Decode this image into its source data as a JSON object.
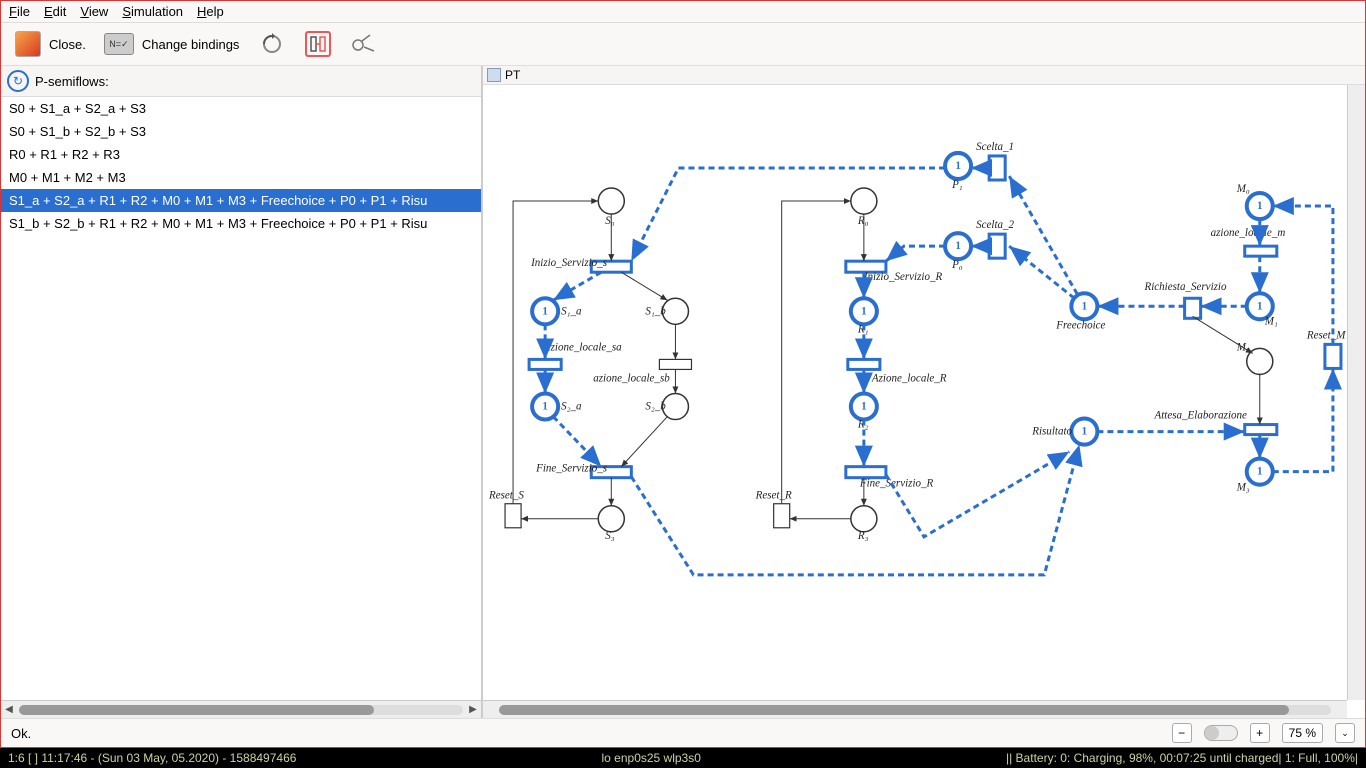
{
  "menubar": {
    "file": "File",
    "edit": "Edit",
    "view": "View",
    "simulation": "Simulation",
    "help": "Help"
  },
  "toolbar": {
    "close": "Close.",
    "change_bindings": "Change bindings"
  },
  "left": {
    "title": "P-semiflows:",
    "items": [
      "S0 + S1_a + S2_a + S3",
      "S0 + S1_b + S2_b + S3",
      "R0 + R1 + R2 + R3",
      "M0 + M1 + M2 + M3",
      "S1_a + S2_a + R1 + R2 + M0 + M1 + M3 + Freechoice + P0 + P1 + Risu",
      "S1_b + S2_b + R1 + R2 + M0 + M1 + M3 + Freechoice + P0 + P1 + Risu"
    ],
    "selected_index": 4
  },
  "tab": {
    "label": "PT"
  },
  "status": {
    "ok": "Ok."
  },
  "zoom": {
    "value": "75 %"
  },
  "sysbar": {
    "left": "1:6 [ ]    11:17:46 - (Sun 03 May, 05.2020) - 1588497466",
    "mid": "lo enp0s25 wlp3s0",
    "right": "||   Battery: 0: Charging, 98%, 00:07:25 until charged| 1: Full, 100%|"
  },
  "net": {
    "S0": "S₀",
    "S1a": "S₁_a",
    "S1b": "S₁_b",
    "S2a": "S₂_a",
    "S2b": "S₂_b",
    "S3": "S₃",
    "R0": "R₀",
    "R1": "R₁",
    "R2": "R₂",
    "R3": "R₃",
    "M0": "M₀",
    "M1": "M₁",
    "M2": "M₂",
    "M3": "M₃",
    "P0": "P₀",
    "P1": "P₁",
    "Freechoice": "Freechoice",
    "Risultato": "Risultato",
    "t_Inizio_S": "Inizio_Servizio_s",
    "t_az_sa": "azione_locale_sa",
    "t_az_sb": "azione_locale_sb",
    "t_Fine_S": "Fine_Servizio_s",
    "t_Reset_S": "Reset_S",
    "t_Inizio_R": "Inizio_Servizio_R",
    "t_az_R": "Azione_locale_R",
    "t_Fine_R": "Fine_Servizio_R",
    "t_Reset_R": "Reset_R",
    "t_Scelta1": "Scelta_1",
    "t_Scelta2": "Scelta_2",
    "t_az_m": "azione_locale_m",
    "t_Rich": "Richiesta_Servizio",
    "t_Attesa": "Attesa_Elaborazione",
    "t_Reset_M": "Reset_M"
  }
}
